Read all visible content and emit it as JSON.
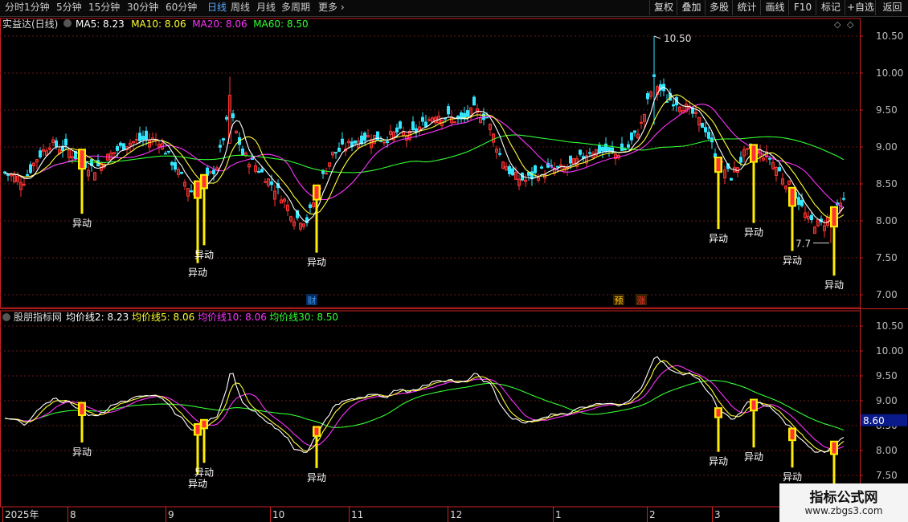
{
  "toolbar": {
    "timeframes": [
      "分时",
      "1分钟",
      "5分钟",
      "15分钟",
      "30分钟",
      "60分钟",
      "日线",
      "周线",
      "月线",
      "多周期",
      "更多"
    ],
    "selected": "日线",
    "right_buttons": [
      "复权",
      "叠加",
      "多股",
      "统计",
      "画线",
      "F10",
      "标记",
      "+自选",
      "返回"
    ]
  },
  "main_panel": {
    "title": "实益达(日线)",
    "ma_labels": [
      {
        "text": "MA5: 8.23",
        "color": "#ffffff"
      },
      {
        "text": "MA10: 8.06",
        "color": "#ffff33"
      },
      {
        "text": "MA20: 8.06",
        "color": "#ff33ff"
      },
      {
        "text": "MA60: 8.50",
        "color": "#33ff33"
      }
    ],
    "y_ticks": [
      "10.50",
      "10.00",
      "9.50",
      "9.00",
      "8.50",
      "8.00",
      "7.50",
      "7.00"
    ],
    "high_label": "10.50",
    "low_label": "7.7",
    "event_badges": [
      "财",
      "预",
      "涨"
    ]
  },
  "sub_panel": {
    "title": "股朋指标网",
    "ma_labels": [
      {
        "text": "均价线2: 8.23",
        "color": "#ffffff"
      },
      {
        "text": "均价线5: 8.06",
        "color": "#ffff33"
      },
      {
        "text": "均价线10: 8.06",
        "color": "#ff33ff"
      },
      {
        "text": "均价线30: 8.50",
        "color": "#33ff33"
      }
    ],
    "y_ticks": [
      "10.50",
      "10.00",
      "9.50",
      "9.00",
      "8.50",
      "8.00",
      "7.50"
    ],
    "current_value": "8.60"
  },
  "signal_text": "异动",
  "time_axis": [
    "2025年",
    "8",
    "9",
    "10",
    "11",
    "12",
    "1",
    "2",
    "3"
  ],
  "watermark": {
    "line1": "指标公式网",
    "line2": "www.zbgs3.com"
  },
  "colors": {
    "up": "#ff3333",
    "down": "#33e6ff",
    "signal": "#ffee00",
    "grid": "#6a1a1a",
    "axis": "#cc2222"
  },
  "chart_data": {
    "type": "candlestick",
    "symbol": "实益达",
    "period": "日线",
    "ylim": [
      6.9,
      10.7
    ],
    "sub_ylim": [
      7.4,
      10.7
    ],
    "visible_extremes": {
      "high": 10.5,
      "low": 7.7
    },
    "last_ma": {
      "MA5": 8.23,
      "MA10": 8.06,
      "MA20": 8.06,
      "MA60": 8.5
    },
    "anchors": [
      [
        0,
        8.65
      ],
      [
        6,
        8.55
      ],
      [
        10,
        8.85
      ],
      [
        14,
        9.05
      ],
      [
        20,
        8.95
      ],
      [
        24,
        8.8
      ],
      [
        28,
        8.7
      ],
      [
        33,
        8.9
      ],
      [
        38,
        9.05
      ],
      [
        43,
        9.1
      ],
      [
        48,
        9.1
      ],
      [
        54,
        8.65
      ],
      [
        58,
        8.4
      ],
      [
        62,
        8.5
      ],
      [
        66,
        8.75
      ],
      [
        70,
        9.5
      ],
      [
        74,
        8.9
      ],
      [
        78,
        8.75
      ],
      [
        82,
        8.55
      ],
      [
        86,
        8.35
      ],
      [
        90,
        8.05
      ],
      [
        94,
        8.0
      ],
      [
        98,
        8.5
      ],
      [
        102,
        8.9
      ],
      [
        106,
        9.0
      ],
      [
        110,
        9.1
      ],
      [
        114,
        9.15
      ],
      [
        118,
        9.1
      ],
      [
        122,
        9.2
      ],
      [
        126,
        9.15
      ],
      [
        130,
        9.3
      ],
      [
        134,
        9.45
      ],
      [
        138,
        9.4
      ],
      [
        142,
        9.35
      ],
      [
        146,
        9.5
      ],
      [
        150,
        9.4
      ],
      [
        154,
        8.9
      ],
      [
        158,
        8.6
      ],
      [
        162,
        8.55
      ],
      [
        166,
        8.65
      ],
      [
        170,
        8.7
      ],
      [
        174,
        8.7
      ],
      [
        178,
        8.8
      ],
      [
        182,
        8.95
      ],
      [
        186,
        8.95
      ],
      [
        190,
        8.9
      ],
      [
        194,
        9.0
      ],
      [
        198,
        9.3
      ],
      [
        202,
        9.9
      ],
      [
        206,
        9.65
      ],
      [
        210,
        9.6
      ],
      [
        214,
        9.45
      ],
      [
        218,
        9.25
      ],
      [
        222,
        8.8
      ],
      [
        226,
        8.6
      ],
      [
        230,
        8.9
      ],
      [
        234,
        8.95
      ],
      [
        238,
        8.85
      ],
      [
        242,
        8.6
      ],
      [
        246,
        8.35
      ],
      [
        250,
        8.0
      ],
      [
        254,
        7.95
      ],
      [
        258,
        8.1
      ],
      [
        261,
        8.25
      ]
    ],
    "signals": [
      24,
      60,
      62,
      97,
      222,
      233,
      245,
      258
    ]
  }
}
